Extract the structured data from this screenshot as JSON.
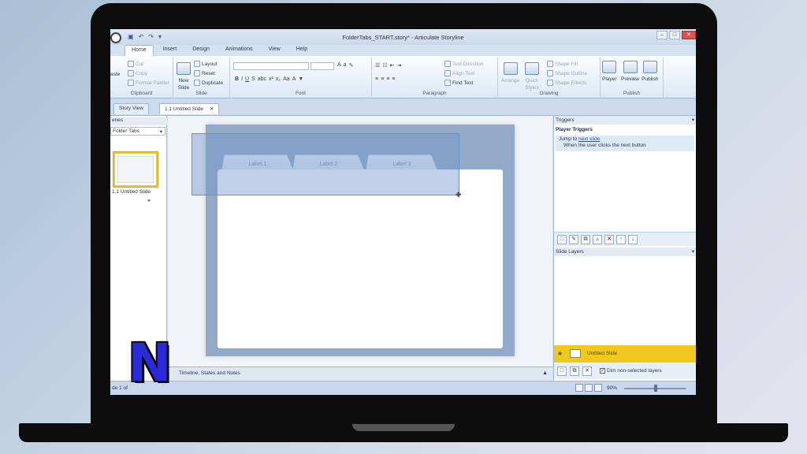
{
  "window": {
    "title": "FolderTabs_START.story* - Articulate Storyline"
  },
  "ribbon_tabs": [
    "Home",
    "Insert",
    "Design",
    "Animations",
    "View",
    "Help"
  ],
  "ribbon": {
    "clipboard": {
      "paste": "aste",
      "cut": "Cut",
      "copy": "Copy",
      "format_painter": "Format Painter",
      "label": "Clipboard"
    },
    "slide": {
      "new_slide": "New",
      "new_slide2": "Slide",
      "layout": "Layout",
      "reset": "Reset",
      "duplicate": "Duplicate",
      "label": "Slide"
    },
    "font": {
      "label": "Font",
      "bold": "B",
      "italic": "I",
      "underline": "U"
    },
    "paragraph": {
      "text_direction": "Text Direction",
      "align_text": "Align Text",
      "find_text": "Find Text",
      "label": "Paragraph"
    },
    "drawing": {
      "arrange": "Arrange",
      "quick_styles": "Quick",
      "quick_styles2": "Styles",
      "shape_fill": "Shape Fill",
      "shape_outline": "Shape Outline",
      "shape_effects": "Shape Effects",
      "label": "Drawing"
    },
    "publish": {
      "player": "Player",
      "preview": "Preview",
      "publish": "Publish",
      "label": "Publish"
    }
  },
  "doc_tabs": {
    "story_view": "Story View",
    "slide_tab": "1.1 Untitled Slide"
  },
  "left_panel": {
    "header": "enes",
    "scene": "Folder Tabs",
    "slide_label": "1.1 Untitled Slide"
  },
  "canvas": {
    "tabs": [
      "Label 1",
      "Label 2",
      "Label 3"
    ]
  },
  "timeline": {
    "label": "Timeline, States and Notes"
  },
  "status": {
    "left": "de 1 of",
    "zoom": "90%"
  },
  "triggers": {
    "header": "Triggers",
    "group": "Player Triggers",
    "action_prefix": "Jump to",
    "action_link": "next slide",
    "condition": "When the user clicks the next button"
  },
  "slide_layers": {
    "header": "Slide Layers",
    "base_layer": "Untitled Slide",
    "dim_label": "Dim non-selected layers"
  },
  "colors": {
    "selection_blue": "#7396cd",
    "layer_yellow": "#f1c81e",
    "n_logo_blue": "#2a2ad8"
  },
  "overlay": {
    "logo_letter": "N"
  }
}
